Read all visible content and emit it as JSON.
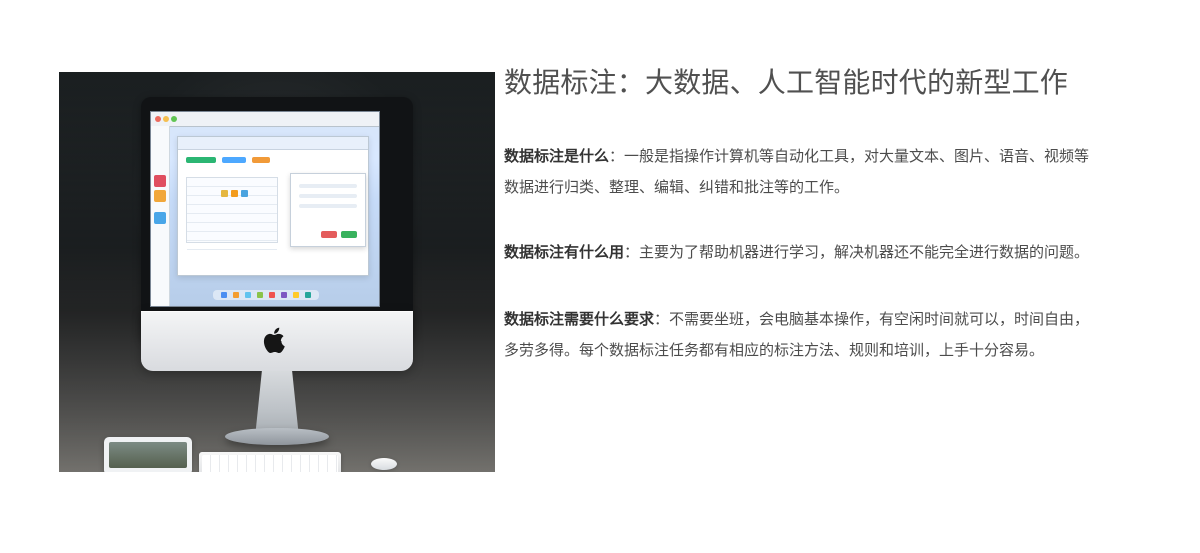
{
  "title": "数据标注：大数据、人工智能时代的新型工作",
  "sections": [
    {
      "label": "数据标注是什么",
      "text": "：一般是指操作计算机等自动化工具，对大量文本、图片、语音、视频等数据进行归类、整理、编辑、纠错和批注等的工作。"
    },
    {
      "label": "数据标注有什么用",
      "text": "：主要为了帮助机器进行学习，解决机器还不能完全进行数据的问题。"
    },
    {
      "label": "数据标注需要什么要求",
      "text": "：不需要坐班，会电脑基本操作，有空闲时间就可以，时间自由，多劳多得。每个数据标注任务都有相应的标注方法、规则和培训，上手十分容易。"
    }
  ],
  "image": {
    "subject": "imac-desktop-photo",
    "icons": [
      "apple-logo",
      "keyboard",
      "mouse",
      "tablet"
    ]
  }
}
